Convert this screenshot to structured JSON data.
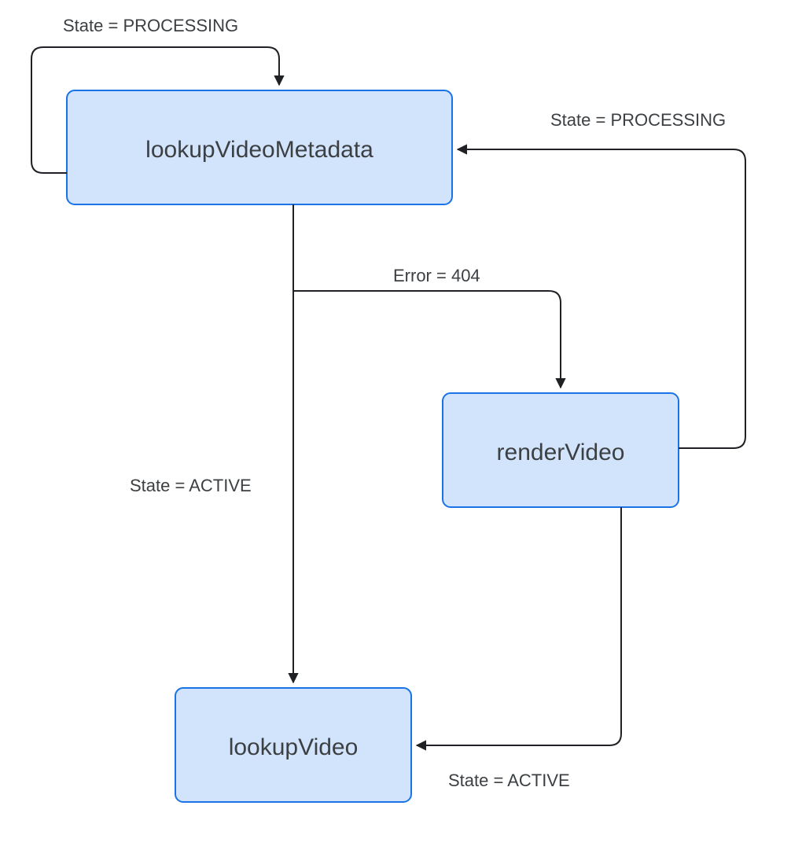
{
  "diagram": {
    "nodes": {
      "lookupVideoMetadata": {
        "label": "lookupVideoMetadata"
      },
      "renderVideo": {
        "label": "renderVideo"
      },
      "lookupVideo": {
        "label": "lookupVideo"
      }
    },
    "edges": {
      "self_processing": {
        "label": "State = PROCESSING"
      },
      "from_render_processing": {
        "label": "State = PROCESSING"
      },
      "to_render_404": {
        "label": "Error = 404"
      },
      "to_lookup_active": {
        "label": "State = ACTIVE"
      },
      "render_to_lookup_active": {
        "label": "State = ACTIVE"
      }
    },
    "colors": {
      "node_fill": "#d2e3fc",
      "node_stroke": "#1a73e8",
      "edge_stroke": "#202124",
      "text": "#3c4043"
    }
  }
}
